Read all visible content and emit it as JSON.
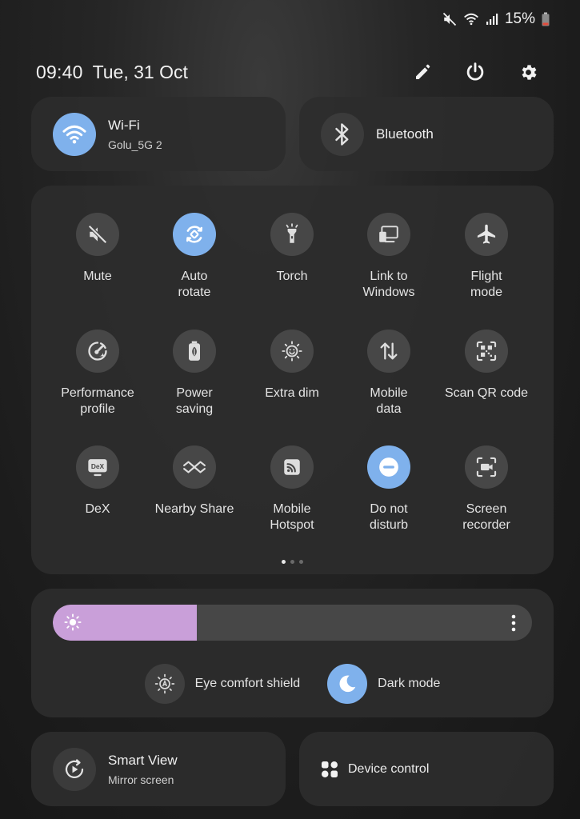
{
  "status": {
    "battery_text": "15%"
  },
  "header": {
    "time": "09:40",
    "date": "Tue, 31 Oct"
  },
  "wifi": {
    "title": "Wi-Fi",
    "network": "Golu_5G 2",
    "on": true
  },
  "bluetooth": {
    "title": "Bluetooth",
    "on": false
  },
  "tiles": [
    {
      "label": "Mute",
      "icon": "mute-icon",
      "on": false
    },
    {
      "label": "Auto\nrotate",
      "icon": "auto-rotate-icon",
      "on": true
    },
    {
      "label": "Torch",
      "icon": "torch-icon",
      "on": false
    },
    {
      "label": "Link to\nWindows",
      "icon": "link-to-windows-icon",
      "on": false
    },
    {
      "label": "Flight\nmode",
      "icon": "airplane-icon",
      "on": false
    },
    {
      "label": "Performance\nprofile",
      "icon": "performance-icon",
      "on": false
    },
    {
      "label": "Power\nsaving",
      "icon": "battery-saver-icon",
      "on": false
    },
    {
      "label": "Extra dim",
      "icon": "extra-dim-icon",
      "on": false
    },
    {
      "label": "Mobile\ndata",
      "icon": "mobile-data-icon",
      "on": false
    },
    {
      "label": "Scan QR code",
      "icon": "qr-code-icon",
      "on": false
    },
    {
      "label": "DeX",
      "icon": "dex-icon",
      "on": false
    },
    {
      "label": "Nearby Share",
      "icon": "nearby-share-icon",
      "on": false
    },
    {
      "label": "Mobile\nHotspot",
      "icon": "hotspot-icon",
      "on": false
    },
    {
      "label": "Do not\ndisturb",
      "icon": "do-not-disturb-icon",
      "on": true
    },
    {
      "label": "Screen\nrecorder",
      "icon": "screen-recorder-icon",
      "on": false
    }
  ],
  "pages": {
    "count": 3,
    "active": 0
  },
  "brightness": {
    "level": 0.3
  },
  "eye_comfort": {
    "label": "Eye comfort shield",
    "on": false
  },
  "dark_mode": {
    "label": "Dark mode",
    "on": true
  },
  "smart_view": {
    "title": "Smart View",
    "sub": "Mirror screen"
  },
  "device_control": {
    "label": "Device control"
  },
  "colors": {
    "accent_on": "#7fb1ec",
    "brightness_fill": "#c99fd9",
    "tile_off": "#474747",
    "card_bg": "#2c2c2c"
  }
}
